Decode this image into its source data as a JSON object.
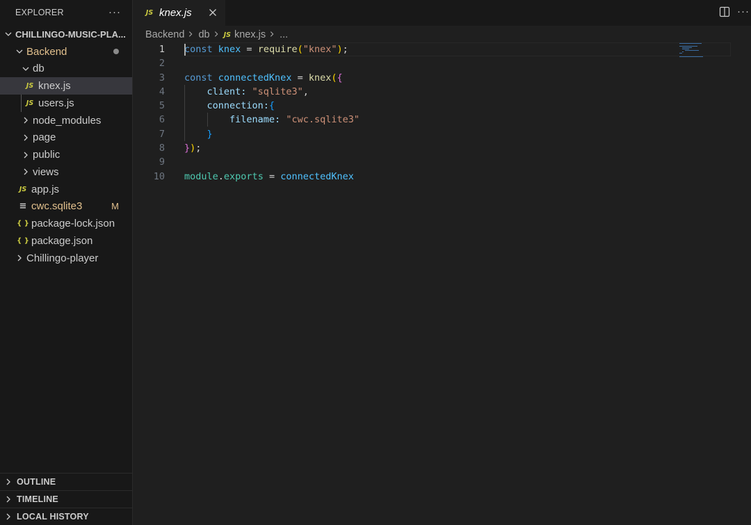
{
  "explorer": {
    "title": "EXPLORER",
    "more": "···",
    "tree": [
      {
        "label": "CHILLINGO-MUSIC-PLA...",
        "kind": "root"
      },
      {
        "label": "Backend",
        "kind": "folder-open"
      },
      {
        "label": "db",
        "kind": "folder-open"
      },
      {
        "label": "knex.js",
        "kind": "js",
        "icon": "JS"
      },
      {
        "label": "users.js",
        "kind": "js",
        "icon": "JS"
      },
      {
        "label": "node_modules",
        "kind": "folder"
      },
      {
        "label": "page",
        "kind": "folder"
      },
      {
        "label": "public",
        "kind": "folder"
      },
      {
        "label": "views",
        "kind": "folder"
      },
      {
        "label": "app.js",
        "kind": "js",
        "icon": "JS"
      },
      {
        "label": "cwc.sqlite3",
        "kind": "db",
        "icon": "≡",
        "badge": "M"
      },
      {
        "label": "package-lock.json",
        "kind": "json",
        "icon": "{ }"
      },
      {
        "label": "package.json",
        "kind": "json",
        "icon": "{ }"
      },
      {
        "label": "Chillingo-player",
        "kind": "folder"
      }
    ],
    "panels": [
      "OUTLINE",
      "TIMELINE",
      "LOCAL HISTORY"
    ]
  },
  "tab": {
    "icon": "JS",
    "label": "knex.js"
  },
  "editor_more": "···",
  "breadcrumb": {
    "parts": [
      "Backend",
      "db"
    ],
    "file_icon": "JS",
    "file": "knex.js",
    "trail": "..."
  },
  "line_numbers": [
    "1",
    "2",
    "3",
    "4",
    "5",
    "6",
    "7",
    "8",
    "9",
    "10"
  ],
  "code": {
    "l1": {
      "kw": "const",
      "var": "knex",
      "op": " = ",
      "fn": "require",
      "open": "(",
      "str": "\"knex\"",
      "close": ")",
      "end": ";"
    },
    "l3": {
      "kw": "const",
      "var": "connectedKnex",
      "op": " = ",
      "fn": "knex",
      "open": "(",
      "brace": "{"
    },
    "l4": {
      "indent": "    ",
      "prop": "client:",
      "str": " \"sqlite3\"",
      "comma": ","
    },
    "l5": {
      "indent": "    ",
      "prop": "connection:",
      "brace": "{"
    },
    "l6": {
      "indent": "        ",
      "prop": "filename:",
      "str": " \"cwc.sqlite3\""
    },
    "l7": {
      "indent": "    ",
      "brace": "}"
    },
    "l8": {
      "brace": "}",
      "close": ")",
      "end": ";"
    },
    "l10": {
      "obj": "module",
      "dot": ".",
      "prop": "exports",
      "op": " = ",
      "var": "connectedKnex"
    }
  },
  "colors": {
    "keyword": "#569cd6",
    "variable": "#4fc1ff",
    "function": "#dcdcaa",
    "string": "#ce9178",
    "modified": "#e2c08d",
    "js_icon": "#cbcb41"
  }
}
